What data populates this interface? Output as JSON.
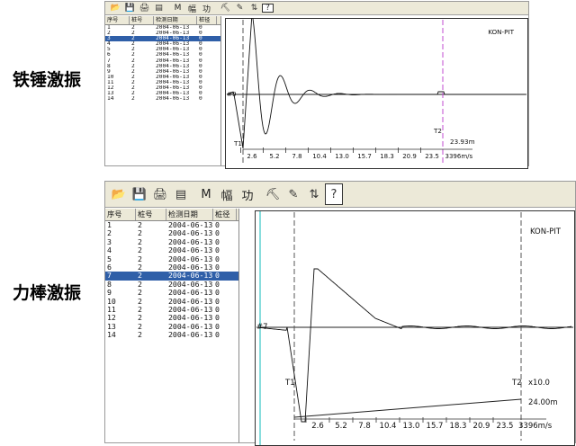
{
  "panels": [
    {
      "caption": "铁锤激振",
      "toolbar": {
        "icons": [
          {
            "name": "open-icon",
            "glyph": "📂"
          },
          {
            "name": "save-icon",
            "glyph": "💾"
          },
          {
            "name": "print-icon",
            "glyph": "🖨"
          },
          {
            "name": "print-preview-icon",
            "glyph": "▤"
          },
          {
            "name": "m-button",
            "glyph": "M",
            "text": true
          },
          {
            "name": "amplitude-button",
            "glyph": "幅",
            "text": true
          },
          {
            "name": "function-button",
            "glyph": "功",
            "text": true
          },
          {
            "name": "pile-icon",
            "glyph": "⛏"
          },
          {
            "name": "tool-icon",
            "glyph": "✎"
          },
          {
            "name": "arrows-icon",
            "glyph": "⇅"
          },
          {
            "name": "help-icon",
            "glyph": "?",
            "help": true
          }
        ]
      },
      "columns": [
        "序号",
        "桩号",
        "检测日期",
        "桩径"
      ],
      "rows": [
        [
          "1",
          "2",
          "2004-06-13",
          "0"
        ],
        [
          "2",
          "2",
          "2004-06-13",
          "0"
        ],
        [
          "3",
          "2",
          "2004-06-13",
          "0"
        ],
        [
          "4",
          "2",
          "2004-06-13",
          "0"
        ],
        [
          "5",
          "2",
          "2004-06-13",
          "0"
        ],
        [
          "6",
          "2",
          "2004-06-13",
          "0"
        ],
        [
          "7",
          "2",
          "2004-06-13",
          "0"
        ],
        [
          "8",
          "2",
          "2004-06-13",
          "0"
        ],
        [
          "9",
          "2",
          "2004-06-13",
          "0"
        ],
        [
          "10",
          "2",
          "2004-06-13",
          "0"
        ],
        [
          "11",
          "2",
          "2004-06-13",
          "0"
        ],
        [
          "12",
          "2",
          "2004-06-13",
          "0"
        ],
        [
          "13",
          "2",
          "2004-06-13",
          "0"
        ],
        [
          "14",
          "2",
          "2004-06-13",
          "0"
        ]
      ],
      "selected_row": 2,
      "plot": {
        "brand": "KON-PIT",
        "trace_label": "#9",
        "t1": "T1",
        "t2": "T2",
        "magnification": "",
        "length": "23.93m",
        "velocity": "3396m/s",
        "ticks": [
          "2.6",
          "5.2",
          "7.8",
          "10.4",
          "13.0",
          "15.7",
          "18.3",
          "20.9",
          "23.5"
        ]
      }
    },
    {
      "caption": "力棒激振",
      "toolbar": {
        "icons": [
          {
            "name": "open-icon",
            "glyph": "📂"
          },
          {
            "name": "save-icon",
            "glyph": "💾"
          },
          {
            "name": "print-icon",
            "glyph": "🖨"
          },
          {
            "name": "print-preview-icon",
            "glyph": "▤"
          },
          {
            "name": "m-button",
            "glyph": "M",
            "text": true
          },
          {
            "name": "amplitude-button",
            "glyph": "幅",
            "text": true
          },
          {
            "name": "function-button",
            "glyph": "功",
            "text": true
          },
          {
            "name": "pile-icon",
            "glyph": "⛏"
          },
          {
            "name": "tool-icon",
            "glyph": "✎"
          },
          {
            "name": "arrows-icon",
            "glyph": "⇅"
          },
          {
            "name": "help-icon",
            "glyph": "?",
            "help": true
          }
        ]
      },
      "columns": [
        "序号",
        "桩号",
        "检测日期",
        "桩径"
      ],
      "rows": [
        [
          "1",
          "2",
          "2004-06-13",
          "0"
        ],
        [
          "2",
          "2",
          "2004-06-13",
          "0"
        ],
        [
          "3",
          "2",
          "2004-06-13",
          "0"
        ],
        [
          "4",
          "2",
          "2004-06-13",
          "0"
        ],
        [
          "5",
          "2",
          "2004-06-13",
          "0"
        ],
        [
          "6",
          "2",
          "2004-06-13",
          "0"
        ],
        [
          "7",
          "2",
          "2004-06-13",
          "0"
        ],
        [
          "8",
          "2",
          "2004-06-13",
          "0"
        ],
        [
          "9",
          "2",
          "2004-06-13",
          "0"
        ],
        [
          "10",
          "2",
          "2004-06-13",
          "0"
        ],
        [
          "11",
          "2",
          "2004-06-13",
          "0"
        ],
        [
          "12",
          "2",
          "2004-06-13",
          "0"
        ],
        [
          "13",
          "2",
          "2004-06-13",
          "0"
        ],
        [
          "14",
          "2",
          "2004-06-13",
          "0"
        ]
      ],
      "selected_row": 6,
      "plot": {
        "brand": "KON-PIT",
        "trace_label": "#7",
        "t1": "T1",
        "t2": "T2",
        "magnification": "x10.0",
        "length": "24.00m",
        "velocity": "3396m/s",
        "ticks": [
          "2.6",
          "5.2",
          "7.8",
          "10.4",
          "13.0",
          "15.7",
          "18.3",
          "20.9",
          "23.5"
        ]
      }
    }
  ]
}
